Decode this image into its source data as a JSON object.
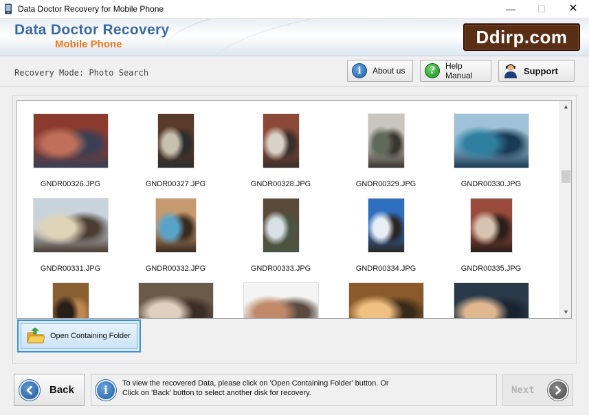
{
  "window": {
    "title": "Data Doctor Recovery for Mobile Phone",
    "minimize": "—",
    "maximize": "☐",
    "close": "✕"
  },
  "banner": {
    "title": "Data Doctor Recovery",
    "subtitle": "Mobile Phone",
    "badge": "Ddirp.com"
  },
  "mode": {
    "label": "Recovery Mode: Photo Search"
  },
  "toolbar": {
    "about_label": "About us",
    "help_label": "Help Manual",
    "support_label": "Support"
  },
  "gallery": {
    "files": [
      {
        "name": "GNDR00326.JPG",
        "colors": [
          "#8a3b2e",
          "#c0705a",
          "#3a3f54"
        ]
      },
      {
        "name": "GNDR00327.JPG",
        "colors": [
          "#5a3a2a",
          "#c8c0ae",
          "#2d2d2d"
        ]
      },
      {
        "name": "GNDR00328.JPG",
        "colors": [
          "#8b4a38",
          "#d9d2c6",
          "#3a2f2a"
        ]
      },
      {
        "name": "GNDR00329.JPG",
        "colors": [
          "#c9c6be",
          "#5f6a5a",
          "#3b3530"
        ]
      },
      {
        "name": "GNDR00330.JPG",
        "colors": [
          "#9ec2d8",
          "#2f7fa0",
          "#1a3b55"
        ]
      },
      {
        "name": "GNDR00331.JPG",
        "colors": [
          "#c9d3dc",
          "#e0d4b8",
          "#4b3d33"
        ]
      },
      {
        "name": "GNDR00332.JPG",
        "colors": [
          "#c59a6e",
          "#5aa3c8",
          "#3a2a20"
        ]
      },
      {
        "name": "GNDR00333.JPG",
        "colors": [
          "#5a4a38",
          "#d8e2e6",
          "#4a5542"
        ]
      },
      {
        "name": "GNDR00334.JPG",
        "colors": [
          "#2f6fc0",
          "#e9eef5",
          "#2a2624"
        ]
      },
      {
        "name": "GNDR00335.JPG",
        "colors": [
          "#9a4a3a",
          "#d8c2b0",
          "#2a1e1a"
        ]
      },
      {
        "name": "",
        "colors": [
          "#8a6030",
          "#2a1f18",
          "#c08850"
        ]
      },
      {
        "name": "",
        "colors": [
          "#6a5a4a",
          "#e0d0c0",
          "#3a2e26"
        ]
      },
      {
        "name": "",
        "colors": [
          "#f4f4f4",
          "#c08a6a",
          "#5a4a40"
        ]
      },
      {
        "name": "",
        "colors": [
          "#8a5a2a",
          "#f0c080",
          "#3a2a1a"
        ]
      },
      {
        "name": "",
        "colors": [
          "#2a3a4a",
          "#e0b890",
          "#1a2430"
        ]
      }
    ]
  },
  "open_folder": {
    "label": "Open Containing Folder"
  },
  "footer": {
    "back_label": "Back",
    "message_line1": "To view the recovered Data, please click on 'Open Containing Folder' button. Or",
    "message_line2": "Click on 'Back' button to select another disk for recovery.",
    "next_label": "Next"
  },
  "colors": {
    "brand_blue": "#3a6aa6",
    "brand_orange": "#f07a1e",
    "badge_brown": "#5a2e14",
    "selection_blue": "#3d8ed6"
  }
}
